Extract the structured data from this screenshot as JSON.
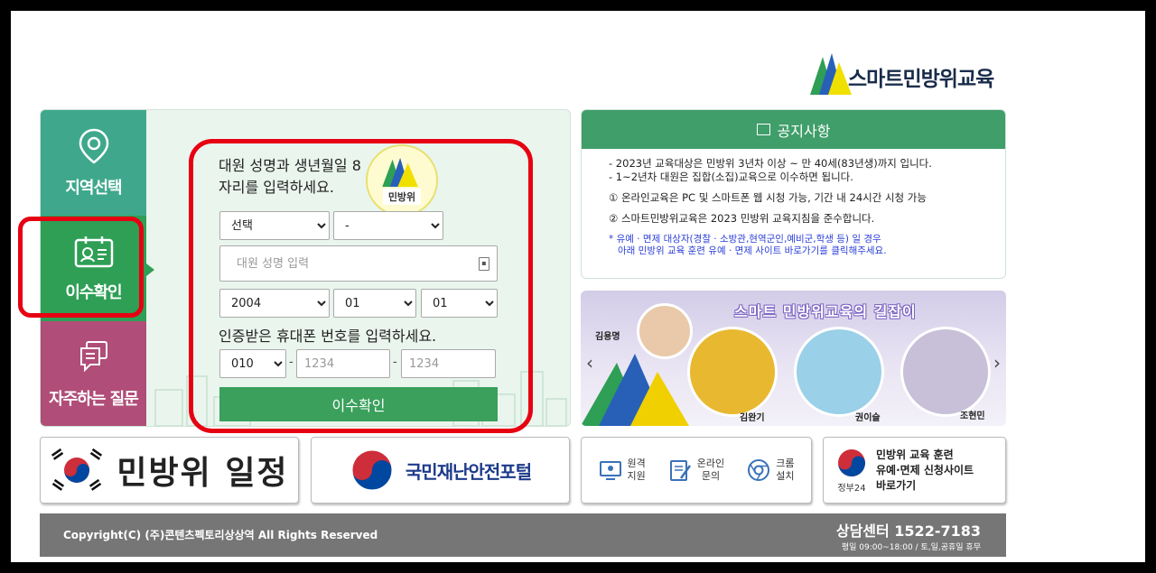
{
  "logo": {
    "text": "스마트민방위교육"
  },
  "tabs": [
    {
      "label": "지역선택",
      "icon": "location-pin-icon"
    },
    {
      "label": "이수확인",
      "icon": "id-card-icon"
    },
    {
      "label": "자주하는 질문",
      "icon": "chat-bubble-icon"
    }
  ],
  "form": {
    "title": "대원 성명과 생년월일 8자리를 입력하세요.",
    "badge_text": "민방위",
    "region_select": "선택",
    "district_select": "-",
    "name_placeholder": "대원 성명 입력",
    "year": "2004",
    "month": "01",
    "day": "01",
    "phone_title": "인증받은 휴대폰 번호를 입력하세요.",
    "phone_prefix": "010",
    "phone_part1_placeholder": "1234",
    "phone_part2_placeholder": "1234",
    "dash": "-",
    "submit_label": "이수확인"
  },
  "notice": {
    "title": "공지사항",
    "lines": [
      "- 2023년 교육대상은 민방위 3년차 이상 ~ 만 40세(83년생)까지 입니다.",
      "- 1~2년차 대원은 집합(소집)교육으로 이수하면 됩니다."
    ],
    "point1": "① 온라인교육은 PC 및 스마트폰 웹 시청 가능, 기간 내 24시간 시청 가능",
    "point2": "② 스마트민방위교육은 2023 민방위 교육지침을 준수합니다.",
    "blue_line1": "* 유예 · 면제 대상자(경찰 · 소방관,현역군인,예비군,학생 등) 일 경우",
    "blue_line2": "아래 민방위 교육 훈련 유예 · 면제 사이트 바로가기를 클릭해주세요."
  },
  "guide": {
    "title": "스마트 민방위교육의 길잡이",
    "people": [
      "김용명",
      "김완기",
      "권이슬",
      "조현민"
    ]
  },
  "bottom": {
    "schedule": "민방위 일정",
    "portal": "국민재난안전포털",
    "services": [
      {
        "label1": "원격",
        "label2": "지원",
        "icon": "remote-support-icon"
      },
      {
        "label1": "온라인",
        "label2": "문의",
        "icon": "online-inquiry-icon"
      },
      {
        "label1": "크롬",
        "label2": "설치",
        "icon": "chrome-icon"
      }
    ],
    "gov_sub": "정부24",
    "gov_line1": "민방위 교육 훈련",
    "gov_line2": "유예·면제 신청사이트",
    "gov_line3": "바로가기"
  },
  "footer": {
    "copyright": "Copyright(C) (주)콘텐츠펙토리상상역 All Rights Reserved",
    "callcenter": "상담센터  1522-7183",
    "hours": "평일 09:00~18:00 / 토,일,공휴일 휴무"
  }
}
